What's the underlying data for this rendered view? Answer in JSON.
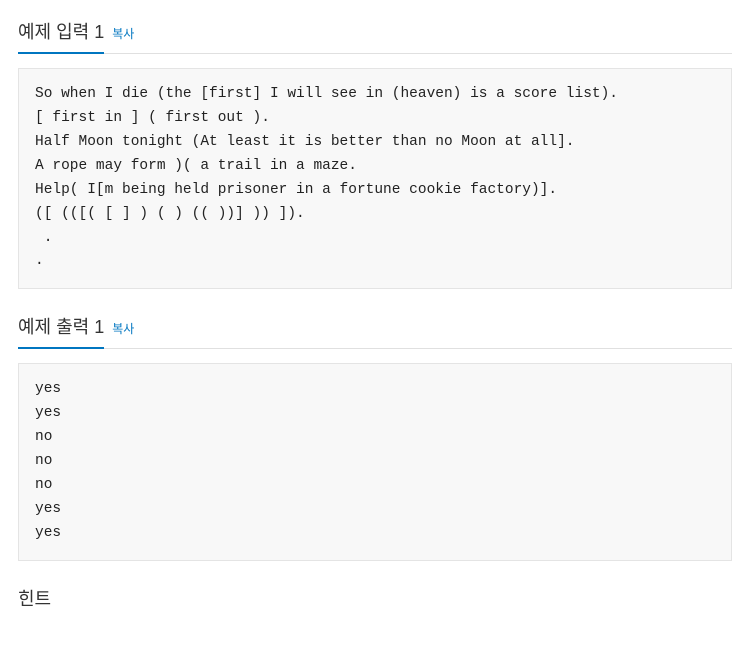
{
  "sections": {
    "input": {
      "title": "예제 입력 1",
      "copy_label": "복사",
      "content": "So when I die (the [first] I will see in (heaven) is a score list).\n[ first in ] ( first out ).\nHalf Moon tonight (At least it is better than no Moon at all].\nA rope may form )( a trail in a maze.\nHelp( I[m being held prisoner in a fortune cookie factory)].\n([ (([( [ ] ) ( ) (( ))] )) ]).\n .\n."
    },
    "output": {
      "title": "예제 출력 1",
      "copy_label": "복사",
      "content": "yes\nyes\nno\nno\nno\nyes\nyes"
    },
    "hint": {
      "title": "힌트"
    }
  }
}
